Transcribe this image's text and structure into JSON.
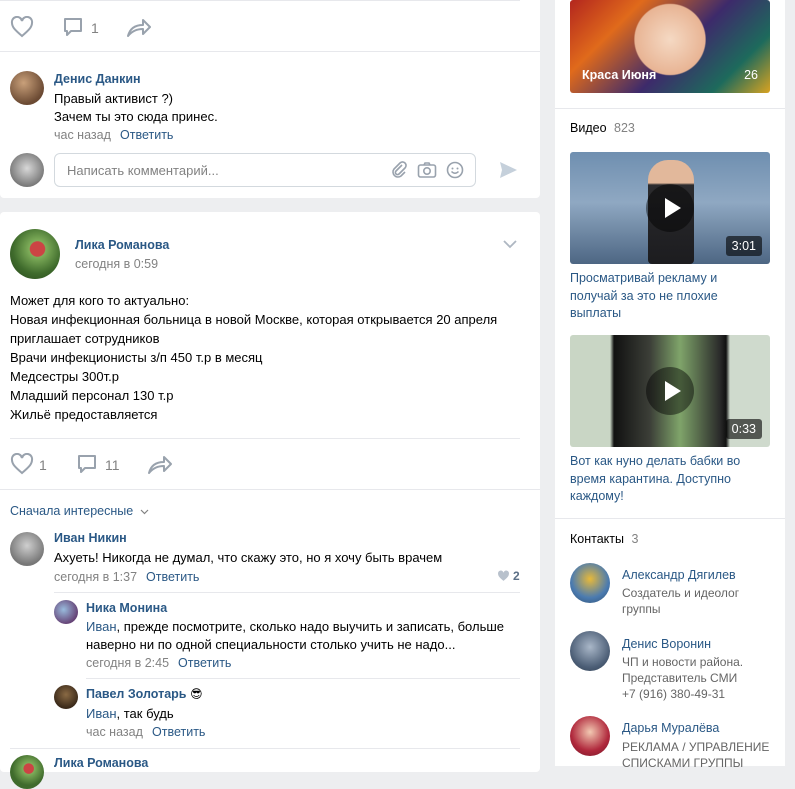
{
  "post1": {
    "likes": "",
    "comments": "1",
    "comment": {
      "author": "Денис Данкин",
      "line1": "Правый активист ?)",
      "line2": "Зачем ты это сюда принес.",
      "time": "час назад",
      "reply": "Ответить"
    },
    "input_placeholder": "Написать комментарий..."
  },
  "post2": {
    "author": "Лика Романова",
    "time": "сегодня в 0:59",
    "text_lines": [
      "Может для кого то актуально:",
      "Новая инфекционная больница в новой Москве, которая открывается 20 апреля",
      "приглашает сотрудников",
      "Врачи инфекционисты з/п 450 т.р в месяц",
      "Медсестры 300т.р",
      "Младший персонал 130 т.р",
      "Жильё предоставляется"
    ],
    "likes": "1",
    "comments": "11",
    "sort_label": "Сначала интересные",
    "comments_list": [
      {
        "author": "Иван Никин",
        "text": "Ахуеть! Никогда не думал, что скажу это, но я хочу быть врачем",
        "time": "сегодня в 1:37",
        "reply": "Ответить",
        "likes": "2"
      },
      {
        "author": "Ника Монина",
        "mention": "Иван",
        "line1": ", прежде посмотрите, сколько надо выучить и записать, больше",
        "line2": "наверно ни по одной специальности столько учить не надо...",
        "time": "сегодня в 2:45",
        "reply": "Ответить"
      },
      {
        "author": "Павел Золотарь",
        "emoji": "😎",
        "mention": "Иван",
        "text": ", так будь",
        "time": "час назад",
        "reply": "Ответить"
      }
    ],
    "next_author": "Лика Романова"
  },
  "sidebar": {
    "album": {
      "title": "Краса Июня",
      "count": "26"
    },
    "videos": {
      "label": "Видео",
      "count": "823"
    },
    "video_items": [
      {
        "duration": "3:01",
        "title_lines": [
          "Просматривай рекламу и",
          "получай за это не плохие",
          "выплаты"
        ]
      },
      {
        "duration": "0:33",
        "title_lines": [
          "Вот как нуно делать бабки во",
          "время карантина. Доступно",
          "каждому!"
        ]
      }
    ],
    "contacts": {
      "label": "Контакты",
      "count": "3"
    },
    "contact_items": [
      {
        "name": "Александр Дягилев",
        "desc": [
          "Создатель и идеолог",
          "группы"
        ]
      },
      {
        "name": "Денис Воронин",
        "desc": [
          "ЧП и новости района.",
          "Представитель СМИ",
          "+7 (916) 380-49-31"
        ]
      },
      {
        "name": "Дарья Муралёва",
        "desc": [
          "РЕКЛАМА / УПРАВЛЕНИЕ",
          "СПИСКАМИ ГРУППЫ"
        ]
      }
    ]
  },
  "colors": {
    "link": "#2a5885",
    "gray": "#828282",
    "bg": "#edeef0",
    "divider": "#e7e8ec"
  }
}
